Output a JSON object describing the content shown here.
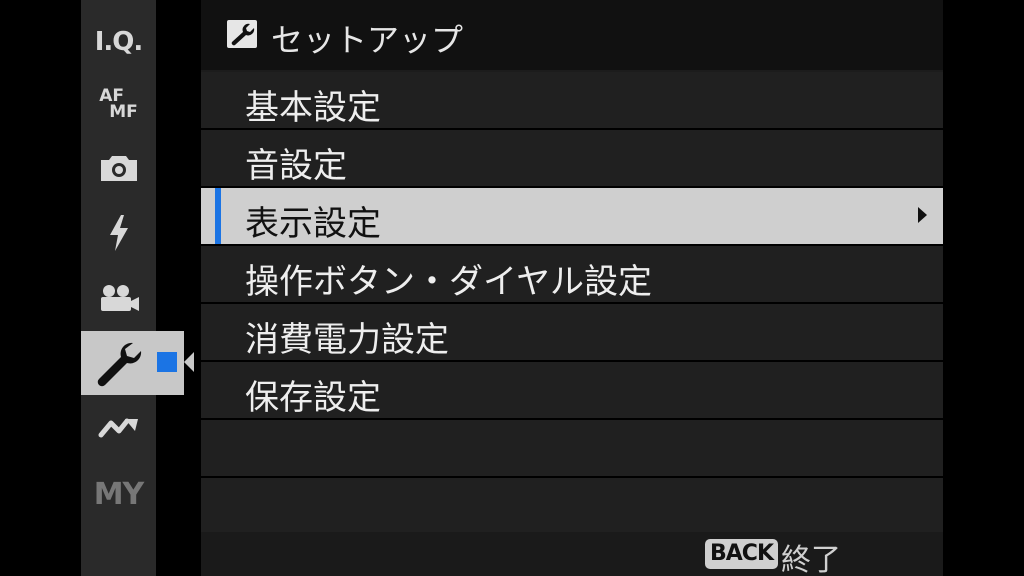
{
  "sidebar": {
    "items": [
      {
        "name": "iq-icon",
        "label": "I.Q."
      },
      {
        "name": "af-mf-icon",
        "label_top": "AF",
        "label_bottom": "MF"
      },
      {
        "name": "camera-icon"
      },
      {
        "name": "flash-icon"
      },
      {
        "name": "movie-camera-icon"
      },
      {
        "name": "wrench-icon",
        "selected": true
      },
      {
        "name": "connection-icon"
      },
      {
        "name": "my-menu-icon",
        "label": "MY"
      }
    ]
  },
  "header": {
    "icon": "wrench-icon",
    "title": "セットアップ"
  },
  "menu": {
    "items": [
      {
        "label": "基本設定"
      },
      {
        "label": "音設定"
      },
      {
        "label": "表示設定",
        "selected": true
      },
      {
        "label": "操作ボタン・ダイヤル設定"
      },
      {
        "label": "消費電力設定"
      },
      {
        "label": "保存設定"
      }
    ]
  },
  "footer": {
    "back_key": "BACK",
    "back_label": "終了"
  },
  "colors": {
    "accent": "#1b74e4",
    "selected_bg": "#cfcfcf"
  }
}
